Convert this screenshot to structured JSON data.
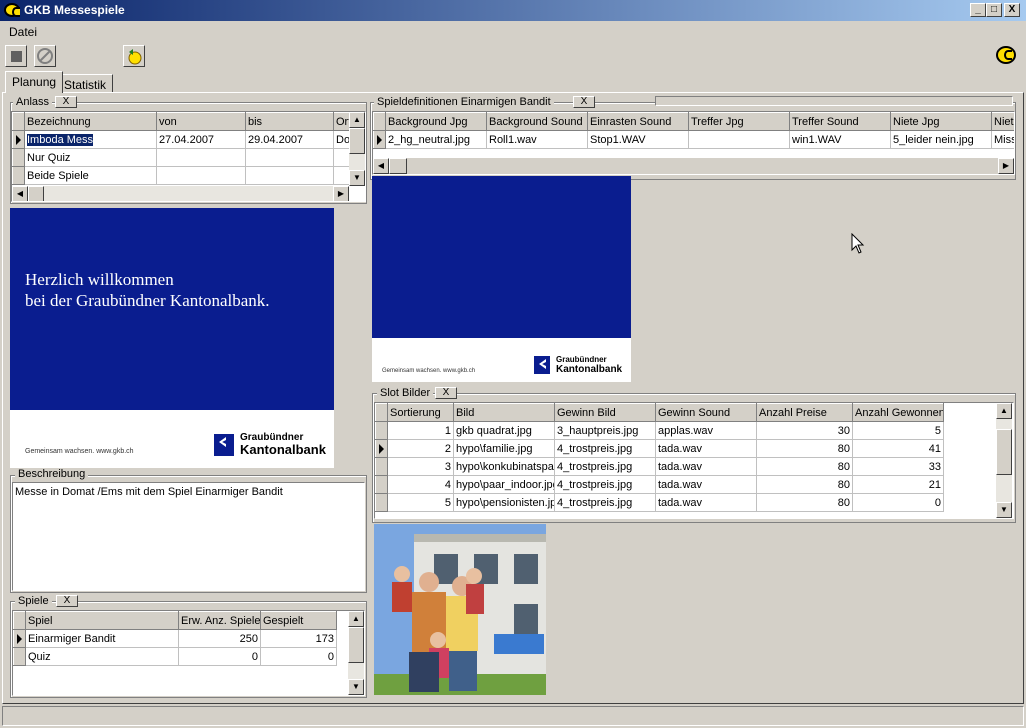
{
  "window": {
    "title": "GKB Messespiele",
    "min": "_",
    "max": "□",
    "close": "X"
  },
  "menu": {
    "datei": "Datei"
  },
  "tabs": [
    {
      "label": "Planung"
    },
    {
      "label": "Statistik"
    }
  ],
  "anlass": {
    "title": "Anlass",
    "close": "X",
    "columns": [
      "Bezeichnung",
      "von",
      "bis",
      "Ort"
    ],
    "rows": [
      {
        "name": "Imboda Mess",
        "von": "27.04.2007",
        "bis": "29.04.2007",
        "ort": "Do"
      },
      {
        "name": "Nur Quiz",
        "von": "",
        "bis": "",
        "ort": ""
      },
      {
        "name": "Beide Spiele",
        "von": "",
        "bis": "",
        "ort": ""
      }
    ]
  },
  "banner_left": {
    "line1": "Herzlich willkommen",
    "line2": "bei der Graubündner Kantonalbank.",
    "small": "Gemeinsam wachsen. www.gkb.ch",
    "bank1": "Graubündner",
    "bank2": "Kantonalbank"
  },
  "beschreibung": {
    "title": "Beschreibung",
    "text": "Messe in Domat /Ems mit dem Spiel Einarmiger Bandit"
  },
  "spiele": {
    "title": "Spiele",
    "close": "X",
    "columns": [
      "Spiel",
      "Erw. Anz. Spiele",
      "Gespielt"
    ],
    "rows": [
      {
        "spiel": "Einarmiger Bandit",
        "erw": "250",
        "gespielt": "173"
      },
      {
        "spiel": "Quiz",
        "erw": "0",
        "gespielt": "0"
      }
    ]
  },
  "spieldef": {
    "title": "Spieldefinitionen Einarmigen Bandit",
    "close": "X",
    "columns": [
      "Background Jpg",
      "Background Sound",
      "Einrasten Sound",
      "Treffer Jpg",
      "Treffer Sound",
      "Niete Jpg",
      "Niet"
    ],
    "row": [
      "2_hg_neutral.jpg",
      "Roll1.wav",
      "Stop1.WAV",
      "",
      "win1.WAV",
      "5_leider nein.jpg",
      "Miss"
    ]
  },
  "banner_right": {
    "small": "Gemeinsam wachsen. www.gkb.ch",
    "bank1": "Graubündner",
    "bank2": "Kantonalbank"
  },
  "slot": {
    "title": "Slot Bilder",
    "close": "X",
    "columns": [
      "Sortierung",
      "Bild",
      "Gewinn Bild",
      "Gewinn Sound",
      "Anzahl Preise",
      "Anzahl Gewonnen"
    ],
    "rows": [
      {
        "sort": "1",
        "bild": "gkb quadrat.jpg",
        "gbild": "3_hauptpreis.jpg",
        "gsound": "applas.wav",
        "preise": "30",
        "gewonnen": "5"
      },
      {
        "sort": "2",
        "bild": "hypo\\familie.jpg",
        "gbild": "4_trostpreis.jpg",
        "gsound": "tada.wav",
        "preise": "80",
        "gewonnen": "41"
      },
      {
        "sort": "3",
        "bild": "hypo\\konkubinatspa",
        "gbild": "4_trostpreis.jpg",
        "gsound": "tada.wav",
        "preise": "80",
        "gewonnen": "33"
      },
      {
        "sort": "4",
        "bild": "hypo\\paar_indoor.jpg",
        "gbild": "4_trostpreis.jpg",
        "gsound": "tada.wav",
        "preise": "80",
        "gewonnen": "21"
      },
      {
        "sort": "5",
        "bild": "hypo\\pensionisten.jpg",
        "gbild": "4_trostpreis.jpg",
        "gsound": "tada.wav",
        "preise": "80",
        "gewonnen": "0"
      }
    ]
  },
  "colors": {
    "titlebar": "#0a246a",
    "banner_blue": "#0a1d8f",
    "face": "#d4d0c8"
  },
  "icons": [
    "app-logo-icon",
    "stop-icon",
    "cancel-icon",
    "refresh-icon",
    "brand-logo-icon"
  ]
}
